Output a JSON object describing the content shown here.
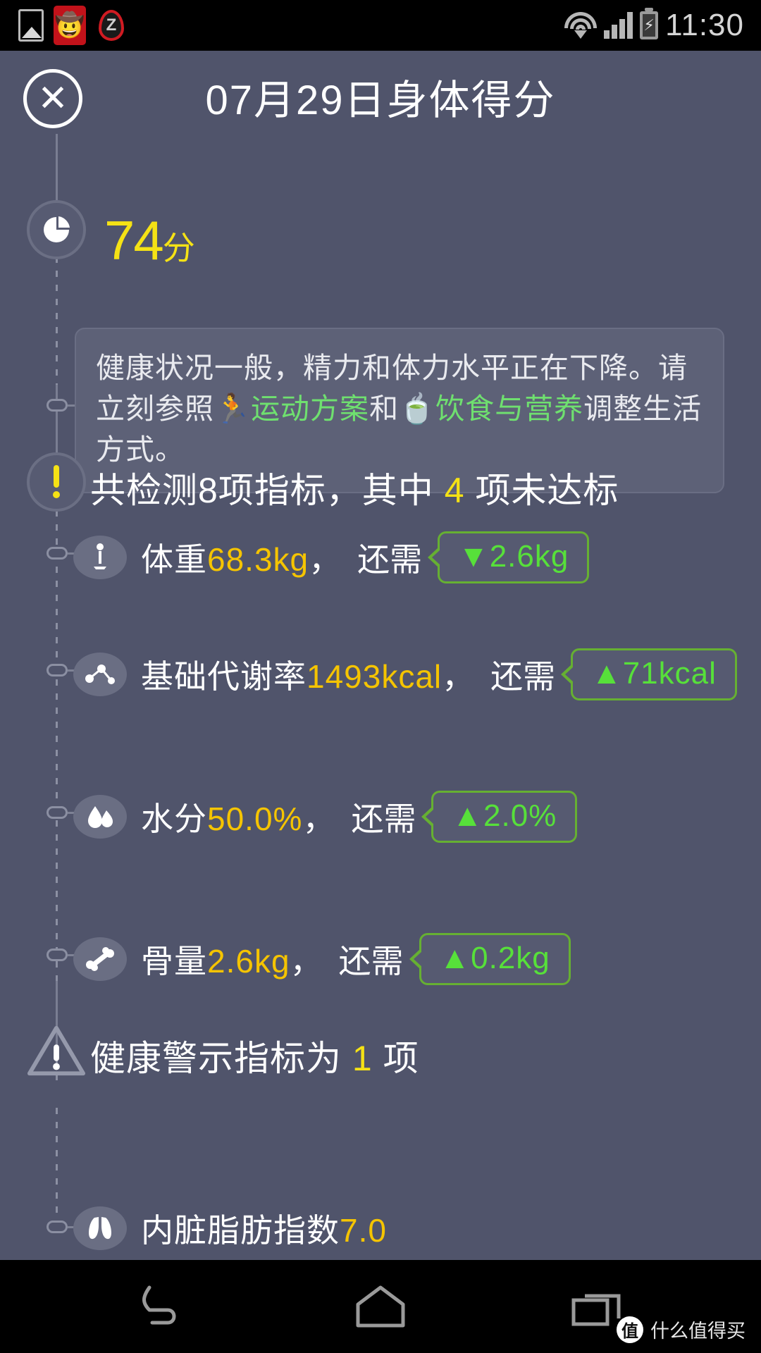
{
  "statusbar": {
    "time": "11:30",
    "icons": [
      "gallery-icon",
      "avatar-notification-icon",
      "alarm-snooze-icon",
      "wifi-icon",
      "cellular-signal-icon",
      "battery-charging-icon"
    ],
    "alarm_letter": "Z",
    "avatar_glyph": "🤠"
  },
  "header": {
    "close_label": "✕",
    "title": "07月29日身体得分"
  },
  "score": {
    "number": "74",
    "unit": "分",
    "color": "#f5e215",
    "icon": "pie-chart-icon"
  },
  "advice": {
    "part1": "健康状况一般，精力和体力水平正在下降。请立刻参照",
    "link1_icon": "🏃",
    "link1": "运动方案",
    "conj": "和",
    "link2_icon": "🍵",
    "link2": "饮食与营养",
    "part2": "调整生活方式。",
    "link_color": "#6fe06f"
  },
  "summary": {
    "icon": "exclamation-circle-icon",
    "prefix": "共检测8项指标，其中",
    "count": "4",
    "suffix": "项未达标"
  },
  "metrics": [
    {
      "icon": "weight-scale-icon",
      "name": "体重",
      "value": "68.3kg",
      "comma": "，",
      "need_label": "还需",
      "delta_arrow": "▼",
      "delta": "2.6kg"
    },
    {
      "icon": "metabolism-icon",
      "name": "基础代谢率",
      "value": "1493kcal",
      "comma": "，",
      "need_label": "还需",
      "delta_arrow": "▲",
      "delta": "71kcal"
    },
    {
      "icon": "water-drop-icon",
      "name": "水分",
      "value": "50.0%",
      "comma": "，",
      "need_label": "还需",
      "delta_arrow": "▲",
      "delta": "2.0%"
    },
    {
      "icon": "bone-icon",
      "name": "骨量",
      "value": "2.6kg",
      "comma": "，",
      "need_label": "还需",
      "delta_arrow": "▲",
      "delta": "0.2kg"
    }
  ],
  "warning": {
    "icon": "warning-triangle-icon",
    "prefix": "健康警示指标为",
    "count": "1",
    "suffix": "项"
  },
  "warning_metrics": [
    {
      "icon": "visceral-organ-icon",
      "name": "内脏脂肪指数",
      "value": "7.0"
    }
  ],
  "navbar": {
    "back": "back-icon",
    "home": "home-icon",
    "recents": "recents-icon"
  },
  "watermark": {
    "badge": "值",
    "text": "什么值得买"
  },
  "theme": {
    "bg": "#50546b",
    "card_bg": "#5d6177",
    "accent_yellow": "#f5e215",
    "value_yellow": "#f5c400",
    "green": "#57e03a",
    "green_border": "#66b032"
  }
}
